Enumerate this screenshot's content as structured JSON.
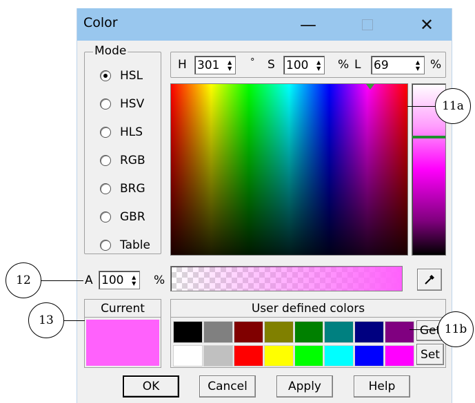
{
  "window": {
    "title": "Color"
  },
  "titlebar_icons": {
    "minimize": "minimize-icon",
    "maximize": "maximize-icon",
    "close": "close-icon"
  },
  "mode": {
    "label": "Mode",
    "options": [
      "HSL",
      "HSV",
      "HLS",
      "RGB",
      "BRG",
      "GBR",
      "Table"
    ],
    "selected": "HSL"
  },
  "hsl": {
    "h_label": "H",
    "h_value": "301",
    "h_unit": "°",
    "s_label": "S",
    "s_value": "100",
    "s_unit": "%",
    "l_label": "L",
    "l_value": "69",
    "l_unit": "%"
  },
  "alpha": {
    "label": "A",
    "value": "100",
    "unit": "%"
  },
  "picker": {
    "icon": "eyedropper-icon"
  },
  "current": {
    "label": "Current",
    "color": "#ff61fc"
  },
  "user_colors": {
    "label": "User defined colors",
    "row1": [
      "#000000",
      "#808080",
      "#800000",
      "#808000",
      "#008000",
      "#008080",
      "#000080",
      "#800080"
    ],
    "row2": [
      "#ffffff",
      "#c0c0c0",
      "#ff0000",
      "#ffff00",
      "#00ff00",
      "#00ffff",
      "#0000ff",
      "#ff00ff"
    ],
    "get_label": "Get",
    "set_label": "Set"
  },
  "buttons": {
    "ok": "OK",
    "cancel": "Cancel",
    "apply": "Apply",
    "help": "Help"
  },
  "callouts": {
    "c11a": "11a",
    "c11b": "11b",
    "c12": "12",
    "c13": "13"
  }
}
